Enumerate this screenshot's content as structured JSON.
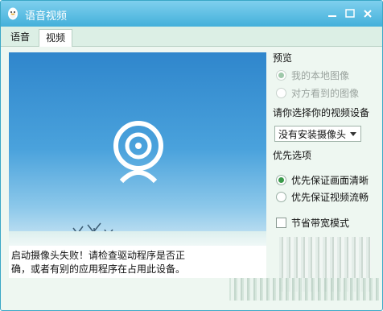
{
  "window": {
    "title": "语音视频"
  },
  "tabs": [
    {
      "label": "语音"
    },
    {
      "label": "视频"
    }
  ],
  "video": {
    "error_line1": "启动摄像头失败！请检查驱动程序是否正",
    "error_line2": "确，或者有别的应用程序在占用此设备。"
  },
  "preview": {
    "title": "预览",
    "option_local": "我的本地图像",
    "option_remote": "对方看到的图像"
  },
  "device": {
    "prompt": "请你选择你的视频设备",
    "selected": "没有安装摄像头"
  },
  "priority": {
    "title": "优先选项",
    "option_clarity": "优先保证画面清晰",
    "option_smooth": "优先保证视频流畅"
  },
  "bandwidth": {
    "label": "节省带宽模式"
  }
}
